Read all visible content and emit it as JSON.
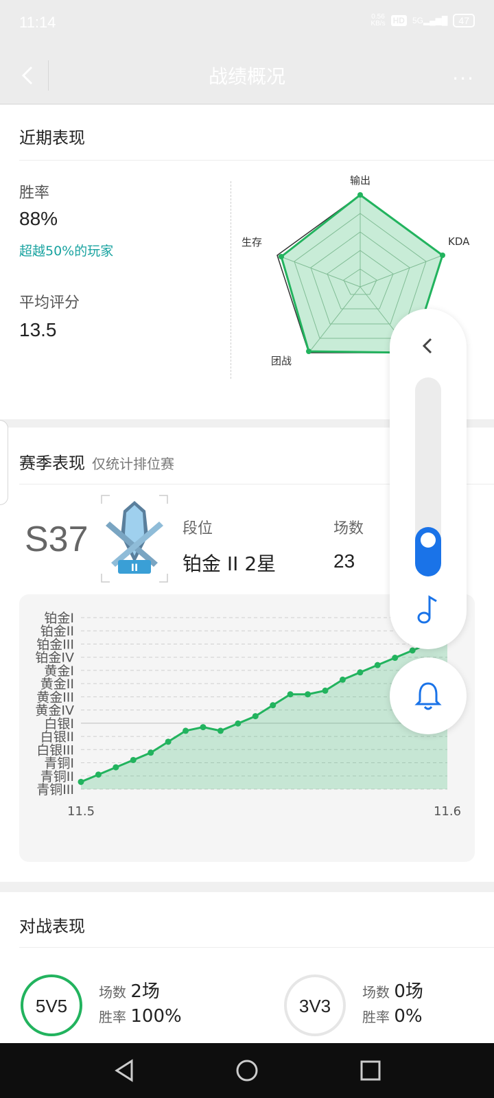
{
  "status": {
    "time": "11:14",
    "net_speed": "0.56",
    "net_unit": "KB/s",
    "hd": "HD",
    "network": "5G",
    "battery": "47"
  },
  "header": {
    "title": "战绩概况",
    "more": "···"
  },
  "recent": {
    "title": "近期表现",
    "win_rate_label": "胜率",
    "win_rate_value": "88%",
    "win_rate_note": "超越50%的玩家",
    "avg_score_label": "平均评分",
    "avg_score_value": "13.5",
    "radar_axes": [
      "输出",
      "KDA",
      "团战",
      "生存"
    ]
  },
  "season": {
    "title": "赛季表现",
    "subtitle": "仅统计排位赛",
    "season_code": "S37",
    "rank_label": "段位",
    "rank_value": "铂金 II 2星",
    "games_label": "场数",
    "games_value": "23",
    "emblem_numeral": "II"
  },
  "chart_data": {
    "type": "line",
    "categories_y": [
      "铂金I",
      "铂金II",
      "铂金III",
      "铂金IV",
      "黄金I",
      "黄金II",
      "黄金III",
      "黄金IV",
      "白银I",
      "白银II",
      "白银III",
      "青铜I",
      "青铜II",
      "青铜III"
    ],
    "x_start_label": "11.5",
    "x_end_label": "11.6",
    "series": [
      {
        "values": [
          1,
          2,
          3,
          4,
          5,
          6.5,
          8,
          8.5,
          8,
          9,
          10,
          11.5,
          13,
          13,
          13.5,
          15,
          16,
          17,
          18,
          19,
          20,
          22
        ]
      }
    ],
    "grid": true,
    "color": "#22b35e"
  },
  "battle": {
    "title": "对战表现",
    "modes": [
      {
        "name": "5V5",
        "games_label": "场数",
        "games_value": "2场",
        "win_label": "胜率",
        "win_value": "100%",
        "color": "#22b35e"
      },
      {
        "name": "3V3",
        "games_label": "场数",
        "games_value": "0场",
        "win_label": "胜率",
        "win_value": "0%",
        "color": "#e6e6e6"
      }
    ]
  },
  "colors": {
    "accent": "#22b35e",
    "teal": "#19a3a0",
    "blue": "#1a73e8"
  }
}
